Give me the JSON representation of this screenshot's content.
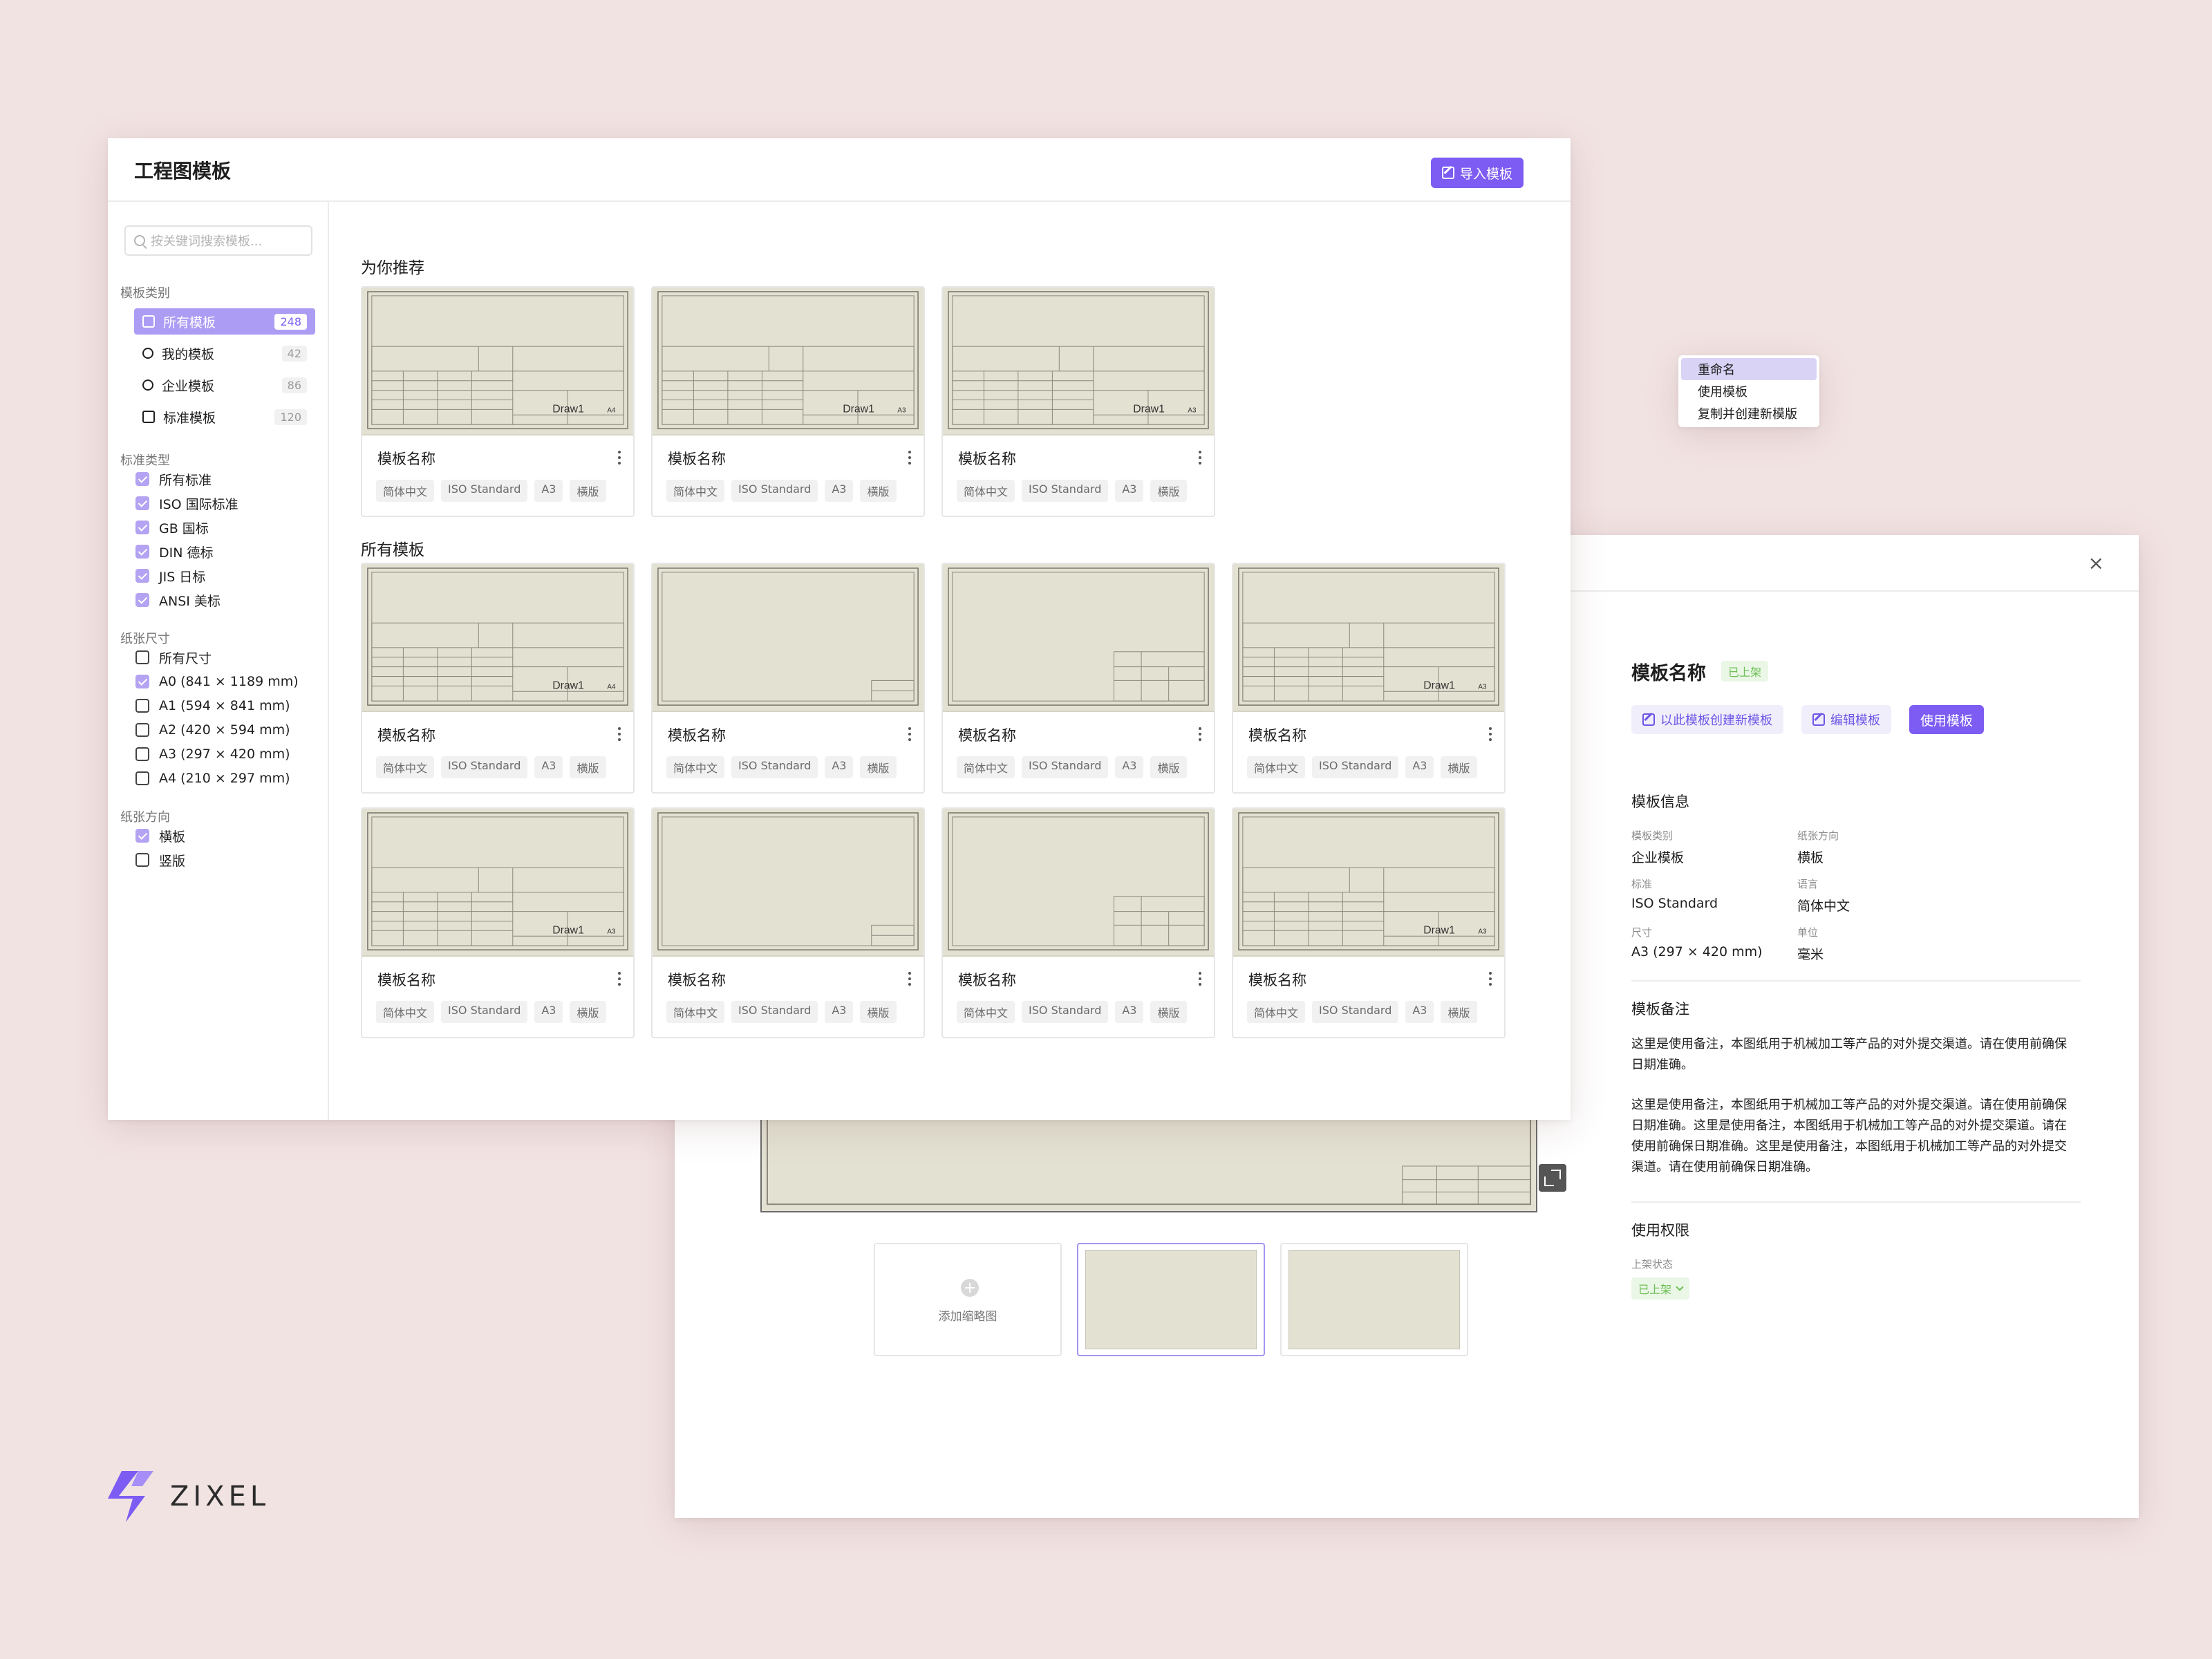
{
  "main_window": {
    "title": "工程图模板",
    "import_button": "导入模板",
    "search_placeholder": "按关键词搜索模板...",
    "category_section": "模板类别",
    "categories": [
      {
        "label": "所有模板",
        "count": "248"
      },
      {
        "label": "我的模板",
        "count": "42"
      },
      {
        "label": "企业模板",
        "count": "86"
      },
      {
        "label": "标准模板",
        "count": "120"
      }
    ],
    "standard_section": "标准类型",
    "standards": [
      "所有标准",
      "ISO 国际标准",
      "GB 国标",
      "DIN 德标",
      "JIS 日标",
      "ANSI 美标"
    ],
    "size_section": "纸张尺寸",
    "sizes": [
      "所有尺寸",
      "A0 (841 × 1189 mm)",
      "A1 (594 × 841 mm)",
      "A2 (420 × 594 mm)",
      "A3 (297 × 420 mm)",
      "A4 (210 × 297 mm)"
    ],
    "orientation_section": "纸张方向",
    "orientations": [
      "横板",
      "竖版"
    ],
    "recommended_title": "为你推荐",
    "all_title": "所有模板",
    "card_name": "模板名称",
    "card_tags": [
      "简体中文",
      "ISO Standard",
      "A3",
      "横版"
    ],
    "title_block_text": "Draw1",
    "sheet_size_labels": [
      "A4",
      "A3"
    ]
  },
  "context_menu": {
    "items": [
      "重命名",
      "使用模板",
      "复制并创建新模版"
    ]
  },
  "detail_panel": {
    "close": "×",
    "title": "模板名称",
    "status": "已上架",
    "create_button": "以此模板创建新模板",
    "edit_button": "编辑模板",
    "use_button": "使用模板",
    "add_thumbnail": "添加缩略图",
    "info_section": "模板信息",
    "info": [
      {
        "label": "模板类别",
        "value": "企业模板"
      },
      {
        "label": "纸张方向",
        "value": "横板"
      },
      {
        "label": "标准",
        "value": "ISO Standard"
      },
      {
        "label": "语言",
        "value": "简体中文"
      },
      {
        "label": "尺寸",
        "value": "A3 (297 × 420 mm)"
      },
      {
        "label": "单位",
        "value": "毫米"
      }
    ],
    "note_section": "模板备注",
    "note_1": "这里是使用备注，本图纸用于机械加工等产品的对外提交渠道。请在使用前确保日期准确。",
    "note_2": "这里是使用备注，本图纸用于机械加工等产品的对外提交渠道。请在使用前确保日期准确。这里是使用备注，本图纸用于机械加工等产品的对外提交渠道。请在使用前确保日期准确。这里是使用备注，本图纸用于机械加工等产品的对外提交渠道。请在使用前确保日期准确。",
    "permission_section": "使用权限",
    "publish_label": "上架状态",
    "publish_value": "已上架"
  },
  "logo": {
    "text": "ZIXEL"
  },
  "colors": {
    "accent": "#7c5cf2",
    "accent_light": "#ad9cf4",
    "background": "#f2e3e3",
    "paper": "#e3e1d2",
    "status_green": "#6cbf56"
  }
}
